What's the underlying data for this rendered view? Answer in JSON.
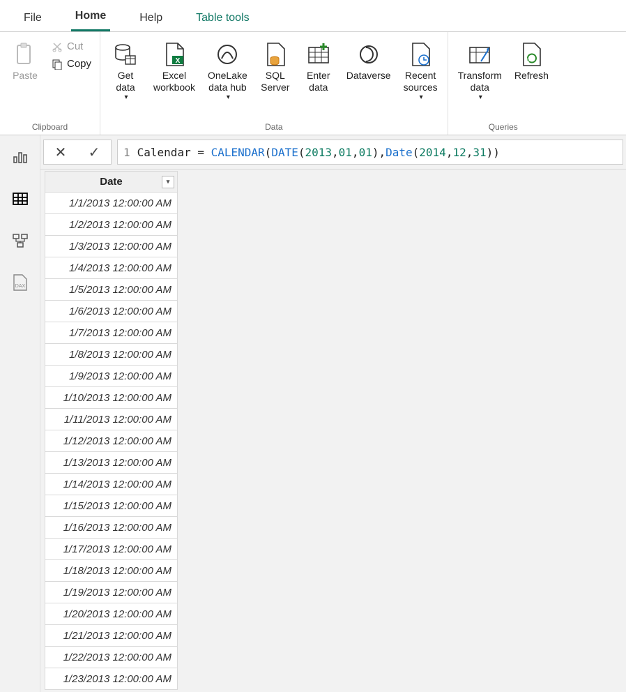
{
  "tabs": {
    "file": "File",
    "home": "Home",
    "help": "Help",
    "tabletools": "Table tools"
  },
  "ribbon": {
    "clipboard": {
      "label": "Clipboard",
      "paste": "Paste",
      "cut": "Cut",
      "copy": "Copy"
    },
    "data": {
      "label": "Data",
      "getdata": "Get\ndata",
      "excel": "Excel\nworkbook",
      "onelake": "OneLake\ndata hub",
      "sql": "SQL\nServer",
      "enter": "Enter\ndata",
      "dataverse": "Dataverse",
      "recent": "Recent\nsources"
    },
    "queries": {
      "label": "Queries",
      "transform": "Transform\ndata",
      "refresh": "Refresh"
    }
  },
  "formula": {
    "line": "1",
    "text_plain": "Calendar = CALENDAR(DATE(2013,01,01),Date(2014,12,31))",
    "tokens": {
      "a": "Calendar = ",
      "b": "CALENDAR",
      "c": "(",
      "d": "DATE",
      "e": "(",
      "f": "2013",
      "g": ",",
      "h": "01",
      "i": ",",
      "j": "01",
      "k": ")",
      "l": ",",
      "m": "Date",
      "n": "(",
      "o": "2014",
      "p": ",",
      "q": "12",
      "r": ",",
      "s": "31",
      "t": ")",
      "u": ")"
    }
  },
  "table": {
    "header": "Date",
    "rows": [
      "1/1/2013 12:00:00 AM",
      "1/2/2013 12:00:00 AM",
      "1/3/2013 12:00:00 AM",
      "1/4/2013 12:00:00 AM",
      "1/5/2013 12:00:00 AM",
      "1/6/2013 12:00:00 AM",
      "1/7/2013 12:00:00 AM",
      "1/8/2013 12:00:00 AM",
      "1/9/2013 12:00:00 AM",
      "1/10/2013 12:00:00 AM",
      "1/11/2013 12:00:00 AM",
      "1/12/2013 12:00:00 AM",
      "1/13/2013 12:00:00 AM",
      "1/14/2013 12:00:00 AM",
      "1/15/2013 12:00:00 AM",
      "1/16/2013 12:00:00 AM",
      "1/17/2013 12:00:00 AM",
      "1/18/2013 12:00:00 AM",
      "1/19/2013 12:00:00 AM",
      "1/20/2013 12:00:00 AM",
      "1/21/2013 12:00:00 AM",
      "1/22/2013 12:00:00 AM",
      "1/23/2013 12:00:00 AM"
    ]
  }
}
